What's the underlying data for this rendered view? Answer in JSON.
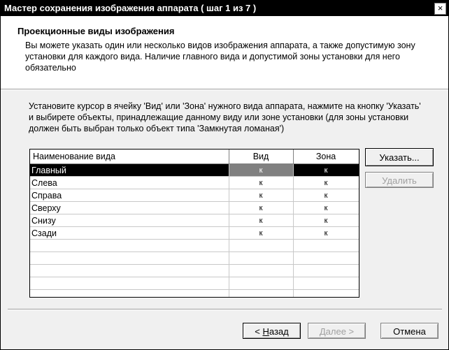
{
  "window": {
    "title": "Мастер сохранения изображения аппарата ( шаг 1 из 7 )",
    "close_glyph": "×"
  },
  "header": {
    "heading": "Проекционные виды изображения",
    "description": "Вы можете указать один или несколько видов изображения аппарата, а также допустимую зону установки для каждого вида. Наличие главного вида и допустимой зоны установки для него обязательно"
  },
  "instructions": "Установите курсор в ячейку 'Вид' или 'Зона' нужного вида аппарата, нажмите на кнопку 'Указать' и выбирете объекты, принадлежащие данному виду или зоне установки (для зоны установки должен быть выбран только объект типа 'Замкнутая ломаная')",
  "grid": {
    "columns": [
      "Наименование вида",
      "Вид",
      "Зона"
    ],
    "rows": [
      {
        "name": "Главный",
        "vid": "к",
        "zona": "к",
        "selected": true
      },
      {
        "name": "Слева",
        "vid": "к",
        "zona": "к"
      },
      {
        "name": "Справа",
        "vid": "к",
        "zona": "к"
      },
      {
        "name": "Сверху",
        "vid": "к",
        "zona": "к"
      },
      {
        "name": "Снизу",
        "vid": "к",
        "zona": "к"
      },
      {
        "name": "Сзади",
        "vid": "к",
        "zona": "к"
      }
    ],
    "empty_row_count": 5
  },
  "buttons": {
    "point": "Указать...",
    "delete": "Удалить",
    "back_prefix": "< ",
    "back_underlined": "Н",
    "back_rest": "азад",
    "next": "Далее >",
    "cancel": "Отмена"
  }
}
